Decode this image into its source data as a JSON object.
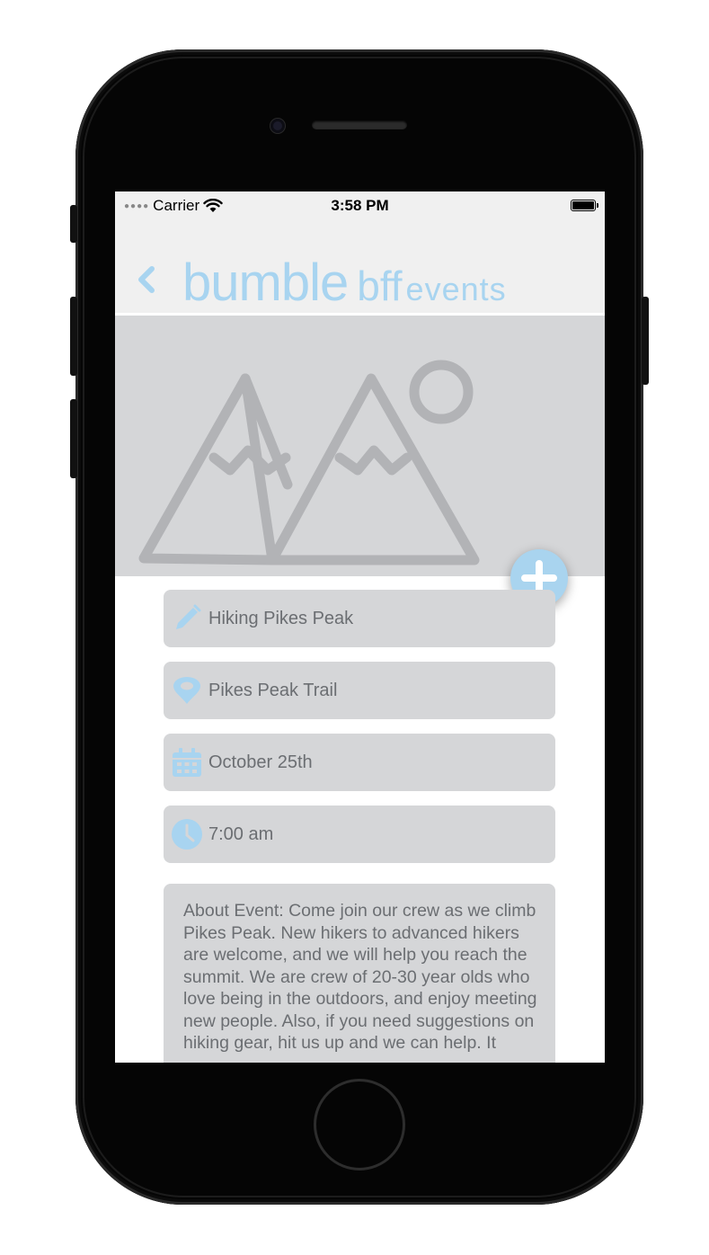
{
  "status_bar": {
    "carrier": "Carrier",
    "time": "3:58 PM",
    "signal_icon": "signal-dots-icon",
    "wifi_icon": "wifi-icon",
    "battery_icon": "battery-icon"
  },
  "header": {
    "back_icon": "chevron-left-icon",
    "logo": {
      "brand": "bumble",
      "sub": "bff",
      "section": "events"
    }
  },
  "hero": {
    "placeholder_icon": "mountain-image-icon",
    "add_button_icon": "plus-icon"
  },
  "fields": {
    "title": {
      "icon": "pencil-icon",
      "value": "Hiking Pikes Peak"
    },
    "location": {
      "icon": "location-pin-icon",
      "value": "Pikes Peak Trail"
    },
    "date": {
      "icon": "calendar-icon",
      "value": "October 25th"
    },
    "time": {
      "icon": "clock-icon",
      "value": "7:00 am"
    }
  },
  "about": {
    "text": "About Event: Come join our crew as we climb Pikes Peak. New hikers to advanced hikers are welcome, and we will help you reach the summit. We are crew of 20-30 year olds who love being in the outdoors, and enjoy meeting new people. Also, if you need suggestions on hiking gear, hit us up and we can help. It"
  },
  "colors": {
    "accent": "#a8d4f0",
    "field_bg": "#d5d6d8",
    "field_text": "#6b6e72",
    "bar_bg": "#f0f0f0"
  }
}
